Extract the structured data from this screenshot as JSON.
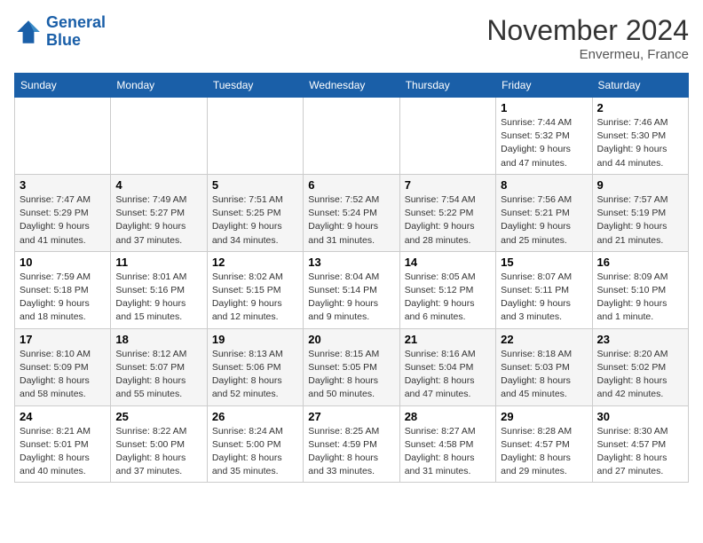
{
  "logo": {
    "line1": "General",
    "line2": "Blue"
  },
  "title": "November 2024",
  "location": "Envermeu, France",
  "days_header": [
    "Sunday",
    "Monday",
    "Tuesday",
    "Wednesday",
    "Thursday",
    "Friday",
    "Saturday"
  ],
  "weeks": [
    [
      {
        "day": "",
        "info": ""
      },
      {
        "day": "",
        "info": ""
      },
      {
        "day": "",
        "info": ""
      },
      {
        "day": "",
        "info": ""
      },
      {
        "day": "",
        "info": ""
      },
      {
        "day": "1",
        "info": "Sunrise: 7:44 AM\nSunset: 5:32 PM\nDaylight: 9 hours and 47 minutes."
      },
      {
        "day": "2",
        "info": "Sunrise: 7:46 AM\nSunset: 5:30 PM\nDaylight: 9 hours and 44 minutes."
      }
    ],
    [
      {
        "day": "3",
        "info": "Sunrise: 7:47 AM\nSunset: 5:29 PM\nDaylight: 9 hours and 41 minutes."
      },
      {
        "day": "4",
        "info": "Sunrise: 7:49 AM\nSunset: 5:27 PM\nDaylight: 9 hours and 37 minutes."
      },
      {
        "day": "5",
        "info": "Sunrise: 7:51 AM\nSunset: 5:25 PM\nDaylight: 9 hours and 34 minutes."
      },
      {
        "day": "6",
        "info": "Sunrise: 7:52 AM\nSunset: 5:24 PM\nDaylight: 9 hours and 31 minutes."
      },
      {
        "day": "7",
        "info": "Sunrise: 7:54 AM\nSunset: 5:22 PM\nDaylight: 9 hours and 28 minutes."
      },
      {
        "day": "8",
        "info": "Sunrise: 7:56 AM\nSunset: 5:21 PM\nDaylight: 9 hours and 25 minutes."
      },
      {
        "day": "9",
        "info": "Sunrise: 7:57 AM\nSunset: 5:19 PM\nDaylight: 9 hours and 21 minutes."
      }
    ],
    [
      {
        "day": "10",
        "info": "Sunrise: 7:59 AM\nSunset: 5:18 PM\nDaylight: 9 hours and 18 minutes."
      },
      {
        "day": "11",
        "info": "Sunrise: 8:01 AM\nSunset: 5:16 PM\nDaylight: 9 hours and 15 minutes."
      },
      {
        "day": "12",
        "info": "Sunrise: 8:02 AM\nSunset: 5:15 PM\nDaylight: 9 hours and 12 minutes."
      },
      {
        "day": "13",
        "info": "Sunrise: 8:04 AM\nSunset: 5:14 PM\nDaylight: 9 hours and 9 minutes."
      },
      {
        "day": "14",
        "info": "Sunrise: 8:05 AM\nSunset: 5:12 PM\nDaylight: 9 hours and 6 minutes."
      },
      {
        "day": "15",
        "info": "Sunrise: 8:07 AM\nSunset: 5:11 PM\nDaylight: 9 hours and 3 minutes."
      },
      {
        "day": "16",
        "info": "Sunrise: 8:09 AM\nSunset: 5:10 PM\nDaylight: 9 hours and 1 minute."
      }
    ],
    [
      {
        "day": "17",
        "info": "Sunrise: 8:10 AM\nSunset: 5:09 PM\nDaylight: 8 hours and 58 minutes."
      },
      {
        "day": "18",
        "info": "Sunrise: 8:12 AM\nSunset: 5:07 PM\nDaylight: 8 hours and 55 minutes."
      },
      {
        "day": "19",
        "info": "Sunrise: 8:13 AM\nSunset: 5:06 PM\nDaylight: 8 hours and 52 minutes."
      },
      {
        "day": "20",
        "info": "Sunrise: 8:15 AM\nSunset: 5:05 PM\nDaylight: 8 hours and 50 minutes."
      },
      {
        "day": "21",
        "info": "Sunrise: 8:16 AM\nSunset: 5:04 PM\nDaylight: 8 hours and 47 minutes."
      },
      {
        "day": "22",
        "info": "Sunrise: 8:18 AM\nSunset: 5:03 PM\nDaylight: 8 hours and 45 minutes."
      },
      {
        "day": "23",
        "info": "Sunrise: 8:20 AM\nSunset: 5:02 PM\nDaylight: 8 hours and 42 minutes."
      }
    ],
    [
      {
        "day": "24",
        "info": "Sunrise: 8:21 AM\nSunset: 5:01 PM\nDaylight: 8 hours and 40 minutes."
      },
      {
        "day": "25",
        "info": "Sunrise: 8:22 AM\nSunset: 5:00 PM\nDaylight: 8 hours and 37 minutes."
      },
      {
        "day": "26",
        "info": "Sunrise: 8:24 AM\nSunset: 5:00 PM\nDaylight: 8 hours and 35 minutes."
      },
      {
        "day": "27",
        "info": "Sunrise: 8:25 AM\nSunset: 4:59 PM\nDaylight: 8 hours and 33 minutes."
      },
      {
        "day": "28",
        "info": "Sunrise: 8:27 AM\nSunset: 4:58 PM\nDaylight: 8 hours and 31 minutes."
      },
      {
        "day": "29",
        "info": "Sunrise: 8:28 AM\nSunset: 4:57 PM\nDaylight: 8 hours and 29 minutes."
      },
      {
        "day": "30",
        "info": "Sunrise: 8:30 AM\nSunset: 4:57 PM\nDaylight: 8 hours and 27 minutes."
      }
    ]
  ]
}
